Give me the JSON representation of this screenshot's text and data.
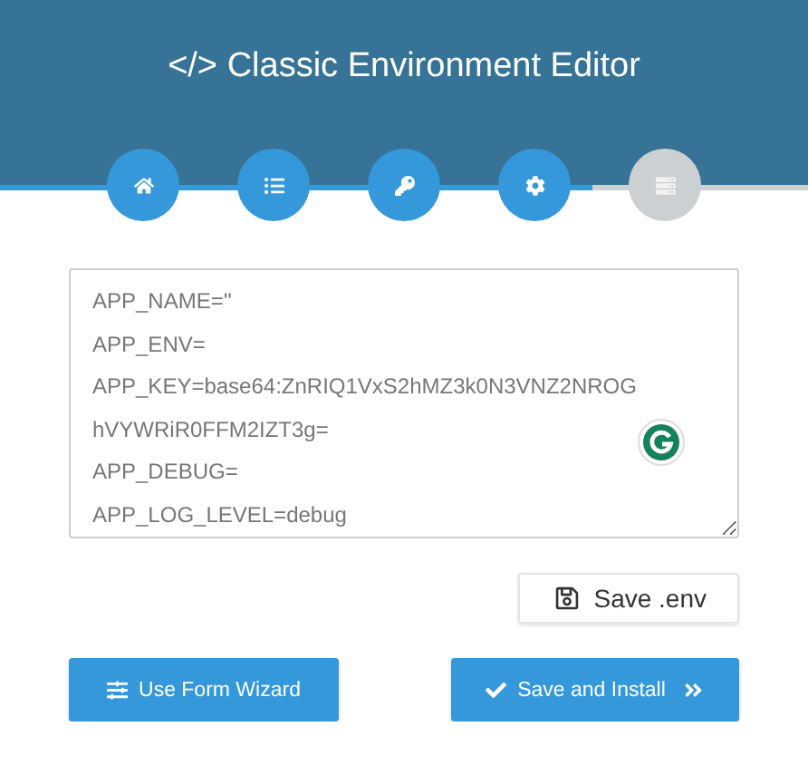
{
  "header": {
    "icon_text": "</>",
    "title": "Classic Environment Editor"
  },
  "steps": [
    {
      "kind": "home",
      "completed": true
    },
    {
      "kind": "list",
      "completed": true
    },
    {
      "kind": "key",
      "completed": true
    },
    {
      "kind": "cog",
      "completed": true
    },
    {
      "kind": "server",
      "completed": false
    }
  ],
  "editor": {
    "lines": [
      "APP_NAME=''",
      "APP_ENV=",
      "APP_KEY=base64:ZnRIQ1VxS2hMZ3k0N3VNZ2NROGhVYWRiR0FFM2IZT3g=",
      "APP_DEBUG=",
      "APP_LOG_LEVEL=debug"
    ]
  },
  "save_button": {
    "label": "Save .env"
  },
  "buttons": [
    {
      "kind": "wizard",
      "label": "Use Form Wizard"
    },
    {
      "kind": "install",
      "label": "Save and Install"
    }
  ]
}
